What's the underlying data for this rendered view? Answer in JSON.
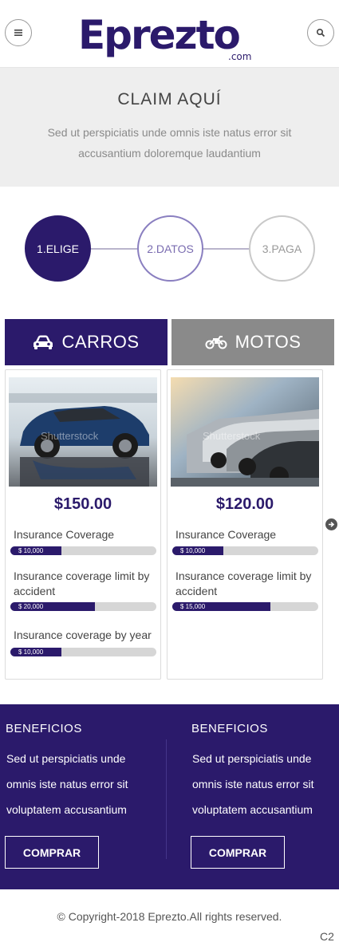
{
  "header": {
    "logo_main": "Eprezto",
    "logo_domain": ".com"
  },
  "claim": {
    "title": "CLAIM AQUÍ",
    "subtitle": "Sed ut perspiciatis unde omnis iste natus error sit accusantium doloremque laudantium"
  },
  "steps": [
    {
      "label": "1.ELIGE",
      "state": "active"
    },
    {
      "label": "2.DATOS",
      "state": "next"
    },
    {
      "label": "3.PAGA",
      "state": "pending"
    }
  ],
  "tabs": {
    "carros": "CARROS",
    "motos": "MOTOS"
  },
  "cards": [
    {
      "price": "$150.00",
      "image_watermark": "Shutterstock",
      "coverages": [
        {
          "label": "Insurance Coverage",
          "value": "$ 10,000",
          "fill": 0.35
        },
        {
          "label": "Insurance coverage limit by accident",
          "value": "$ 20,000",
          "fill": 0.58
        },
        {
          "label": "Insurance coverage by year",
          "value": "$ 10,000",
          "fill": 0.35
        }
      ]
    },
    {
      "price": "$120.00",
      "image_watermark": "Shutterstock",
      "coverages": [
        {
          "label": "Insurance Coverage",
          "value": "$ 10,000",
          "fill": 0.35
        },
        {
          "label": "Insurance coverage limit by accident",
          "value": "$ 15,000",
          "fill": 0.67
        }
      ]
    }
  ],
  "benefits": [
    {
      "title": "BENEFICIOS",
      "text": "Sed ut perspiciatis unde omnis iste natus error sit voluptatem accusantium",
      "button": "COMPRAR"
    },
    {
      "title": "BENEFICIOS",
      "text": "Sed ut perspiciatis unde omnis iste natus error sit voluptatem accusantium",
      "button": "COMPRAR"
    }
  ],
  "footer": {
    "copyright": "© Copyright-2018 Eprezto.All rights reserved.",
    "corner": "C2"
  },
  "colors": {
    "brand": "#2b1a6b",
    "tab_inactive": "#8a8a8a",
    "banner_bg": "#eeeeee"
  },
  "icons": [
    "menu-icon",
    "search-icon",
    "car-icon",
    "motorcycle-icon",
    "arrow-right-icon"
  ]
}
